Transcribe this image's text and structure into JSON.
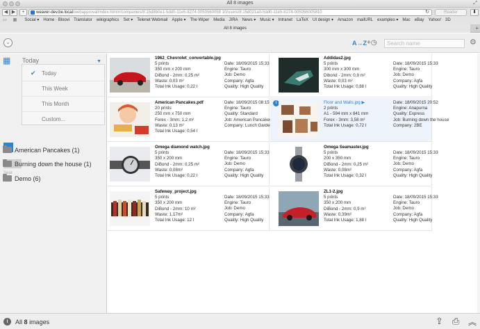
{
  "window": {
    "title": "All 8 images",
    "url_host": "weaver-dev.be.local",
    "url_path": "/webapproval/index.html#/companies/8:15d8b0e1-5dd0-11e5-8274-0050560058 10/users/8:15d021a0-5dd0-11e5-8274-005056005810",
    "reader_label": "Reader"
  },
  "bookmarks": [
    "Social ▾",
    "Home · Bloovi",
    "Translator",
    "wikigraphics",
    "Set ▾",
    "Telenet Webmail",
    "Apple ▾",
    "The Wiper",
    "Media",
    "JIRA",
    "News ▾",
    "Music ▾",
    "Intranet",
    "LaTeX",
    "UI design ▾",
    "Amazon",
    "mailURL",
    "examples ▾",
    "Mac",
    "eBay",
    "Yahoo!",
    "3D"
  ],
  "tab": {
    "label": "All 8 images"
  },
  "toolbar": {
    "sort_label": "A→Z",
    "history_label": "+◷",
    "search_placeholder": "Search name"
  },
  "sidebar": {
    "date_filter": "Today",
    "dropdown_options": [
      "Today",
      "This Week",
      "This Month",
      "Custom..."
    ],
    "search_stub": "Sear",
    "folders": [
      "American Pancakes (1)",
      "Burning down the house (1)",
      "Demo (6)"
    ]
  },
  "cards": [
    {
      "name": "1962_Chevrolet_convertable.jpg",
      "prints": "5 prints",
      "size": "350 mm x 200 mm",
      "material": "DiBond - 2mm: 0,25 m²",
      "waste": "Waste: 0,03 m²",
      "ink": "Total Ink Usage: 0,22 l",
      "date": "Date: 18/09/2015 15:33",
      "engine": "Engine: Tauro",
      "job": "Job: Demo",
      "company": "Company: Agfa",
      "quality": "Quality: High Quality"
    },
    {
      "name": "Addidas2.jpg",
      "prints": "5 prints",
      "size": "300 mm x 300 mm",
      "material": "Dibond - 2mm: 0,9 m²",
      "waste": "Waste: 0,03 m²",
      "ink": "Total Ink Usage: 0,88 l",
      "date": "Date: 18/09/2015 15:33",
      "engine": "Engine: Tauro",
      "job": "Job: Demo",
      "company": "Company: Agfa",
      "quality": "Quality: High Quality"
    },
    {
      "name": "American Pancakes.pdf",
      "prints": "20 prints",
      "size": "250 mm x 750 mm",
      "material": "Forex - 3mm: 1,2 m²",
      "waste": "Waste: 0,13 m²",
      "ink": "Total Ink Usage: 0,54 l",
      "date": "Date: 18/09/2015 08:15",
      "engine": "Engine: Tauro",
      "job": "Quality: Standard",
      "company": "Job: American Pancakes",
      "quality": "Company: Lunch Garden"
    },
    {
      "name": "Floor and Walls.jpg ▶",
      "prints": "2 prints",
      "size": "A1 - 594 mm x 841 mm",
      "material": "Forex - 3mm: 3,58 m²",
      "waste": "",
      "ink": "Total Ink Usage: 0,72 l",
      "date": "Date: 18/09/2015 20:52",
      "engine": "Engine: Anapurna",
      "job": "Quality: Express",
      "company": "Job: Burning down the house",
      "quality": "Company: 2BE"
    },
    {
      "name": "Omega diamond watch.jpg",
      "prints": "5 prints",
      "size": "350 x 200 mm",
      "material": "DiBond - 2mm: 0,25 m²",
      "waste": "Waste: 0,08m²",
      "ink": "Total Ink Usage: 0,22 l",
      "date": "Date: 18/09/2015 15:33",
      "engine": "Engine: Tauro",
      "job": "Job: Demo",
      "company": "Company: Agfa",
      "quality": "Quality: High Quality"
    },
    {
      "name": "Omega Seamaster.jpg",
      "prints": "5 prints",
      "size": "200 x 350 mm",
      "material": "DiBond - 2mm: 0,25 m²",
      "waste": "Waste: 0,08m²",
      "ink": "Total Ink Usage: 0,32 l",
      "date": "Date: 18/09/2015 15:33",
      "engine": "Engine: Tauro",
      "job": "Job: Demo",
      "company": "Company: Agfa",
      "quality": "Quality: High Quality"
    },
    {
      "name": "Safeway_project.jpg",
      "prints": "5 prints",
      "size": "350 x 200 mm",
      "material": "DiBond - 2mm: 10 m²",
      "waste": "Waste: 1,17m²",
      "ink": "Total Ink Usage: 12 l",
      "date": "Date: 18/09/2015 15:33",
      "engine": "Engine: Tauro",
      "job": "Job: Demo",
      "company": "Company: Agfa",
      "quality": "Quality: High Quality"
    },
    {
      "name": "ZL1-2.jpg",
      "prints": "5 prints",
      "size": "350 x 200 mm",
      "material": "DiBond - 2mm: 0,9 m²",
      "waste": "Waste: 0,39m²",
      "ink": "Total Ink Usage: 1,88 l",
      "date": "Date: 18/09/2015 15:33",
      "engine": "Engine: Tauro",
      "job": "Job: Demo",
      "company": "Company: Agfa",
      "quality": "Quality: High Quality"
    }
  ],
  "footer": {
    "prefix": "All",
    "count": "8",
    "suffix": "images"
  },
  "colors": {
    "accent": "#2a84d6",
    "sidebar_bg": "#f0f0f0",
    "toolbar_bg": "#eeeeee"
  }
}
